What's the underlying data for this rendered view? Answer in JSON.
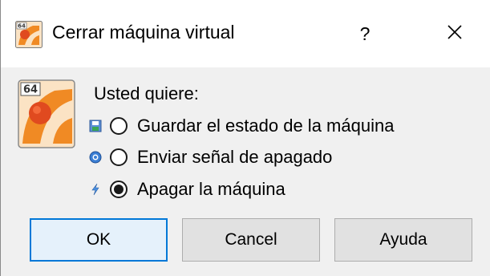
{
  "titlebar": {
    "title": "Cerrar máquina virtual",
    "help_label": "?",
    "close_icon": "close-icon",
    "app_icon": "virtualbox-64-icon"
  },
  "dialog": {
    "prompt": "Usted quiere:",
    "main_icon": "virtualbox-64-icon",
    "options": [
      {
        "label": "Guardar el estado de la máquina",
        "icon": "save-state-icon",
        "checked": false
      },
      {
        "label": "Enviar señal de apagado",
        "icon": "acpi-shutdown-icon",
        "checked": false
      },
      {
        "label": "Apagar la máquina",
        "icon": "power-off-icon",
        "checked": true
      }
    ]
  },
  "buttons": {
    "ok": "OK",
    "cancel": "Cancel",
    "help": "Ayuda"
  },
  "colors": {
    "accent": "#0078d7",
    "icon_orange": "#f08a24",
    "icon_red": "#e04a1f"
  }
}
